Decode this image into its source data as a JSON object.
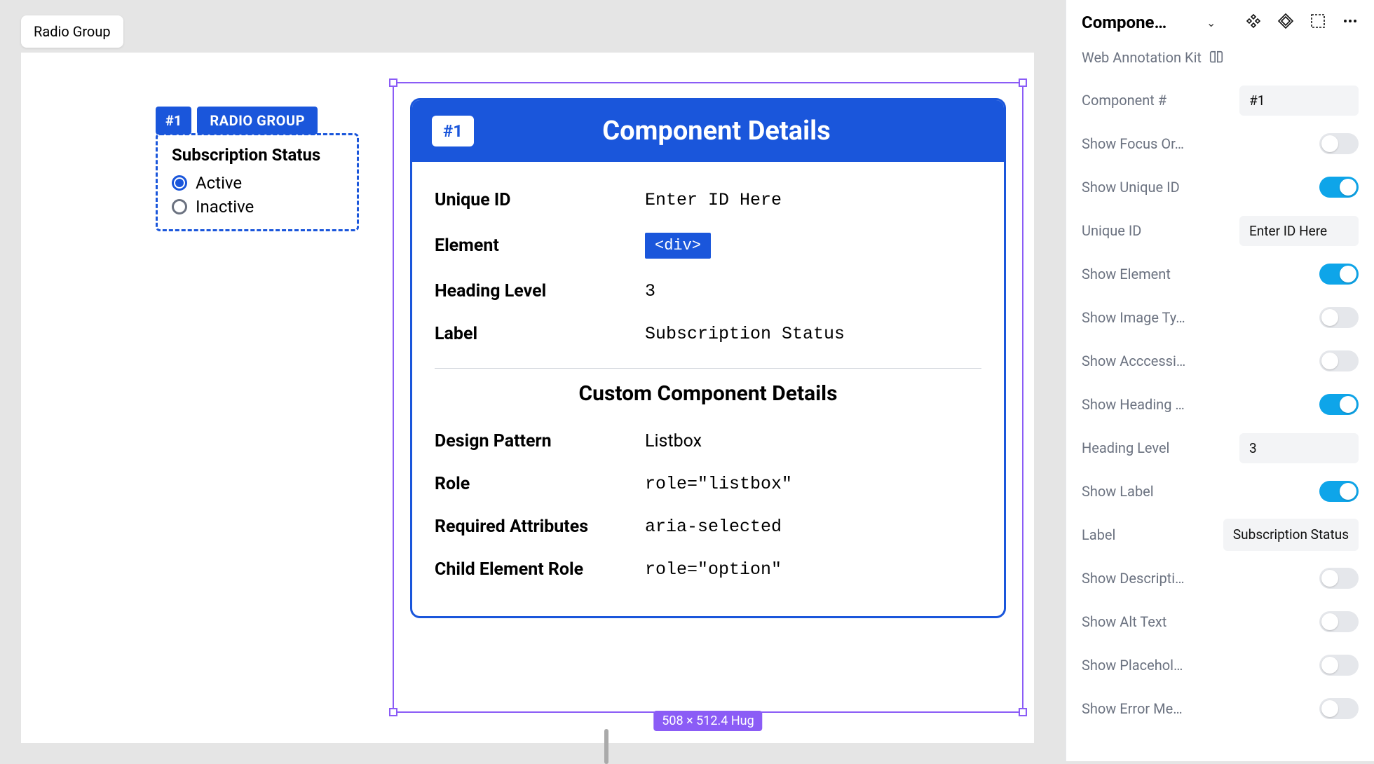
{
  "toolbar": {
    "pill": "Radio Group"
  },
  "annotation": {
    "badge": "#1",
    "name": "RADIO GROUP",
    "title": "Subscription Status",
    "options": [
      "Active",
      "Inactive"
    ]
  },
  "details": {
    "header_badge": "#1",
    "header_title": "Component Details",
    "rows": {
      "unique_id": {
        "label": "Unique ID",
        "value": "Enter ID Here"
      },
      "element": {
        "label": "Element",
        "value": "<div>"
      },
      "heading_level": {
        "label": "Heading Level",
        "value": "3"
      },
      "label": {
        "label": "Label",
        "value": "Subscription Status"
      }
    },
    "subtitle": "Custom Component Details",
    "custom": {
      "design_pattern": {
        "label": "Design Pattern",
        "value": "Listbox"
      },
      "role": {
        "label": "Role",
        "value": "role=\"listbox\""
      },
      "required_attrs": {
        "label": "Required Attributes",
        "value": "aria-selected"
      },
      "child_role": {
        "label": "Child Element Role",
        "value": "role=\"option\""
      }
    }
  },
  "selection": {
    "size_label": "508 × 512.4 Hug"
  },
  "panel": {
    "title": "Compone…",
    "kit": "Web Annotation Kit",
    "props": {
      "component_num": {
        "label": "Component #",
        "value": "#1"
      },
      "show_focus": {
        "label": "Show Focus Or…"
      },
      "show_unique_id": {
        "label": "Show Unique ID"
      },
      "unique_id": {
        "label": "Unique ID",
        "value": "Enter ID Here"
      },
      "show_element": {
        "label": "Show Element"
      },
      "show_image_type": {
        "label": "Show Image Ty…"
      },
      "show_accessi": {
        "label": "Show Acccessi…"
      },
      "show_heading": {
        "label": "Show Heading …"
      },
      "heading_level": {
        "label": "Heading Level",
        "value": "3"
      },
      "show_label": {
        "label": "Show Label"
      },
      "label_value": {
        "label": "Label",
        "value": "Subscription Status"
      },
      "show_descripti": {
        "label": "Show Descripti…"
      },
      "show_alt_text": {
        "label": "Show Alt Text"
      },
      "show_placehol": {
        "label": "Show Placehol…"
      },
      "show_error_me": {
        "label": "Show Error Me…"
      }
    }
  }
}
